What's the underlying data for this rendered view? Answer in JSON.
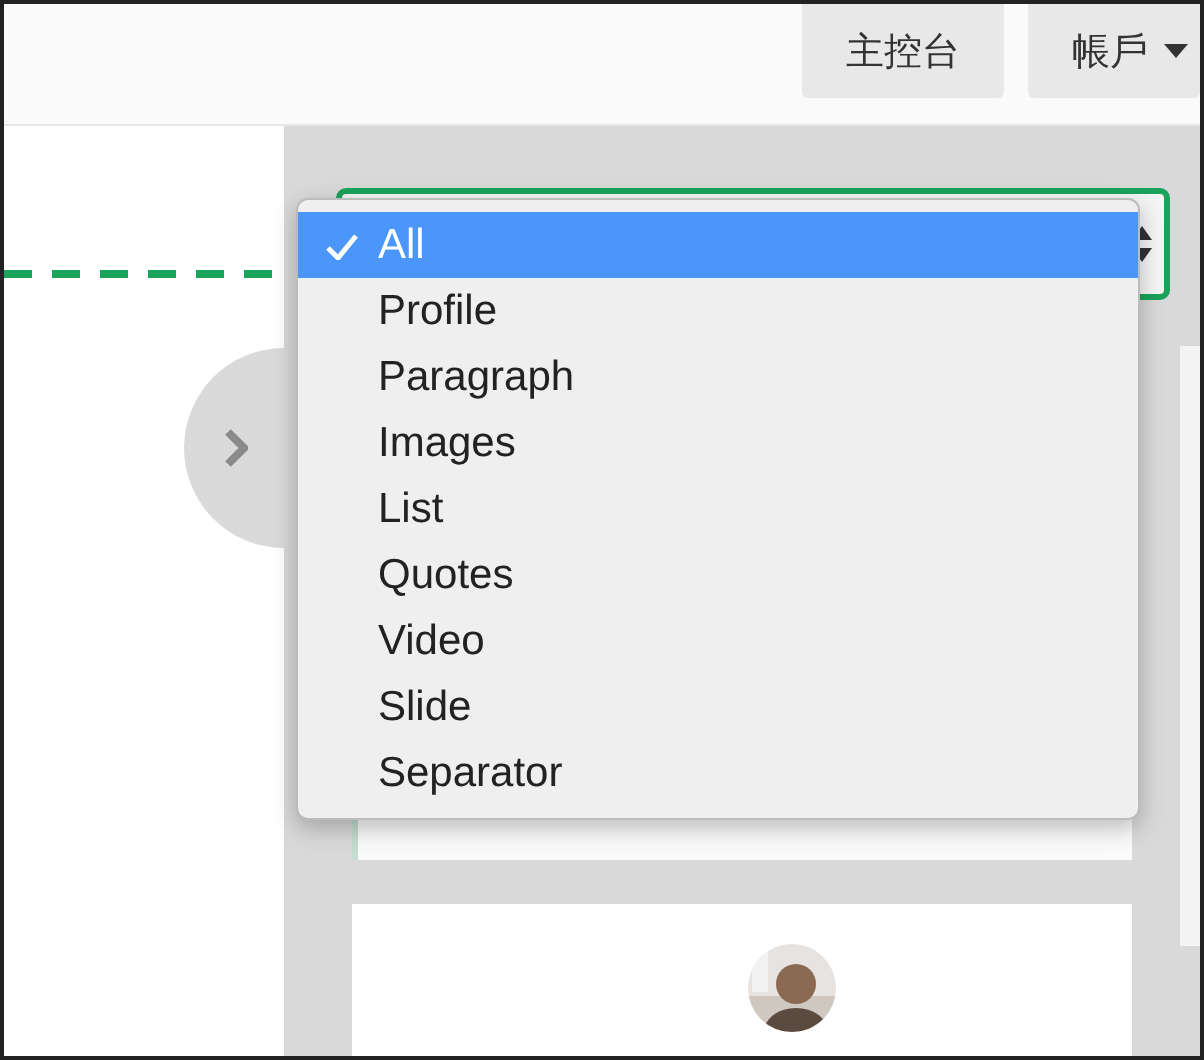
{
  "top_bar": {
    "buttons": [
      {
        "label": "主控台",
        "kind": "button"
      },
      {
        "label": "帳戶",
        "kind": "dropdown"
      }
    ]
  },
  "filter_menu": {
    "options": [
      {
        "label": "All",
        "selected": true
      },
      {
        "label": "Profile",
        "selected": false
      },
      {
        "label": "Paragraph",
        "selected": false
      },
      {
        "label": "Images",
        "selected": false
      },
      {
        "label": "List",
        "selected": false
      },
      {
        "label": "Quotes",
        "selected": false
      },
      {
        "label": "Video",
        "selected": false
      },
      {
        "label": "Slide",
        "selected": false
      },
      {
        "label": "Separator",
        "selected": false
      }
    ]
  },
  "cards": [
    {
      "kind": "plain"
    },
    {
      "kind": "avatar"
    }
  ]
}
